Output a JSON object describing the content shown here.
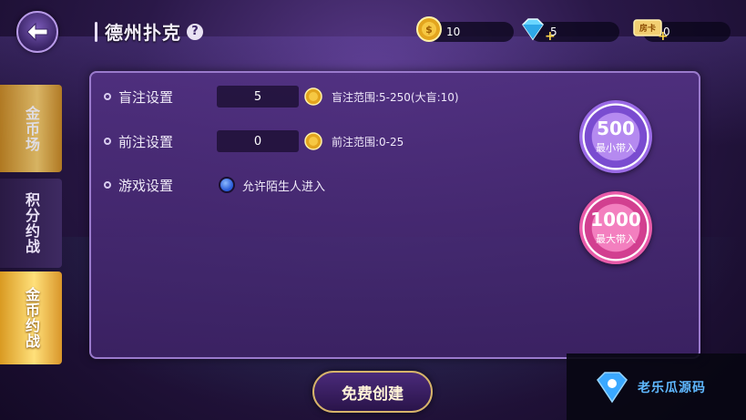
{
  "header": {
    "title": "德州扑克",
    "help_label": "?"
  },
  "resources": {
    "gold": "10",
    "diamond": "5",
    "ticket": "0",
    "ticket_label": "房卡"
  },
  "tabs": [
    {
      "label": "金币场"
    },
    {
      "label": "积分约战"
    },
    {
      "label": "金币约战"
    }
  ],
  "settings": {
    "blind": {
      "label": "盲注设置",
      "value": "5",
      "range": "盲注范围:5-250(大盲:10)"
    },
    "ante": {
      "label": "前注设置",
      "value": "0",
      "range": "前注范围:0-25"
    },
    "game": {
      "label": "游戏设置",
      "option": "允许陌生人进入"
    }
  },
  "chips": {
    "min": {
      "value": "500",
      "label": "最小带入"
    },
    "max": {
      "value": "1000",
      "label": "最大带入"
    }
  },
  "create_button": "免费创建",
  "watermark": "老乐瓜源码",
  "colors": {
    "accent_gold": "#d7b46a",
    "panel": "#50307f",
    "chip_purple": "#9a6ae6",
    "chip_pink": "#e85aa8"
  }
}
